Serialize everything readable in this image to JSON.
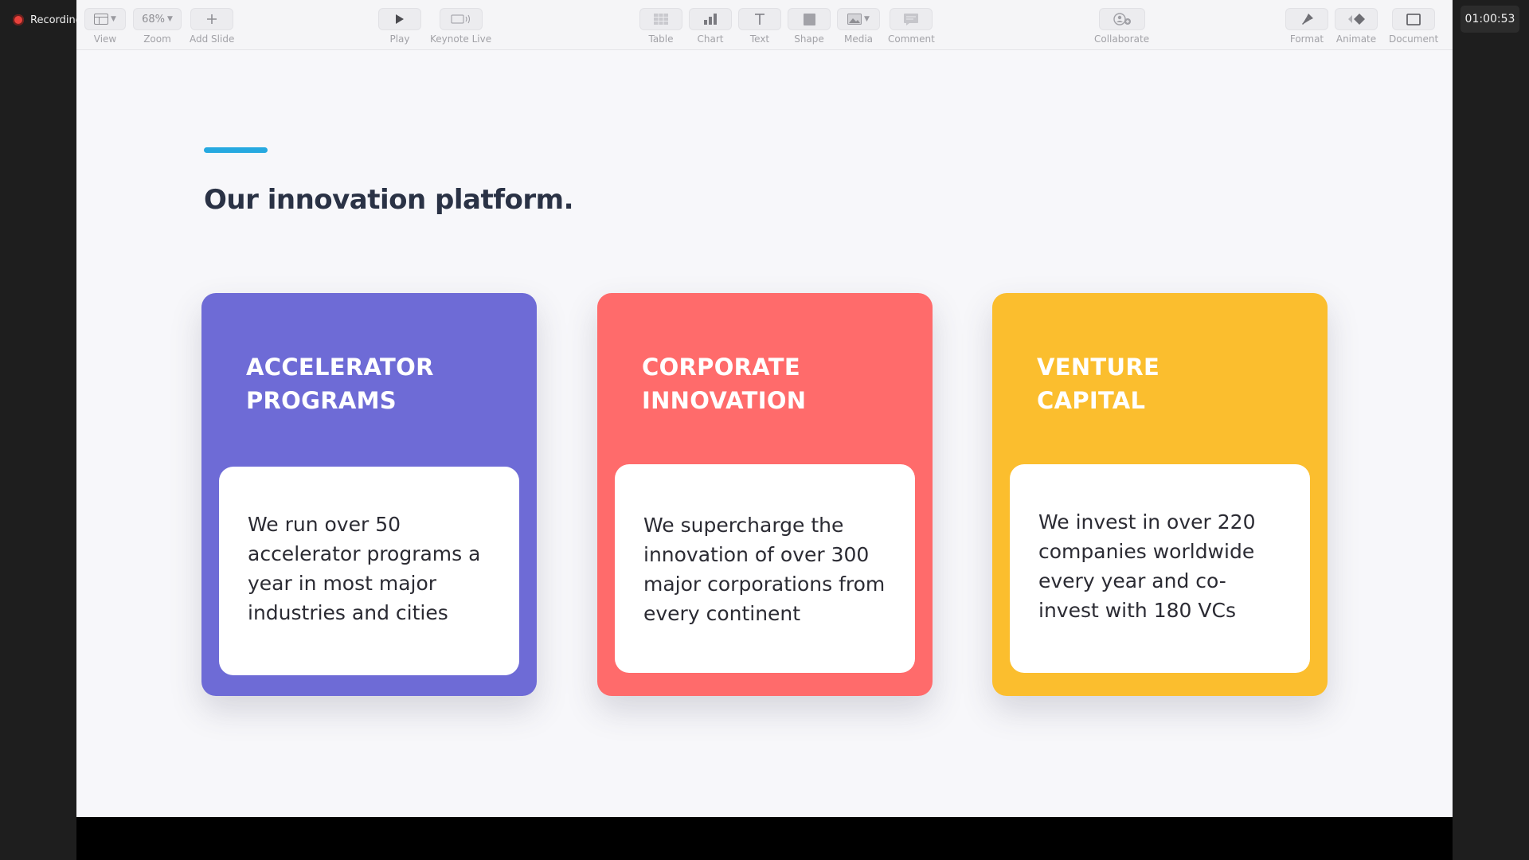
{
  "recording": {
    "label": "Recording"
  },
  "timer": {
    "value": "01:00:53"
  },
  "toolbar": {
    "view": {
      "label": "View",
      "icon": "sidebar-layout-icon"
    },
    "zoom": {
      "label": "Zoom",
      "value": "68%"
    },
    "add_slide": {
      "label": "Add Slide",
      "icon": "plus-icon"
    },
    "play": {
      "label": "Play",
      "icon": "play-icon"
    },
    "keynote_live": {
      "label": "Keynote Live",
      "icon": "broadcast-display-icon"
    },
    "table": {
      "label": "Table",
      "icon": "table-icon"
    },
    "chart": {
      "label": "Chart",
      "icon": "bar-chart-icon"
    },
    "text": {
      "label": "Text",
      "icon": "text-t-icon"
    },
    "shape": {
      "label": "Shape",
      "icon": "square-shape-icon"
    },
    "media": {
      "label": "Media",
      "icon": "image-icon"
    },
    "comment": {
      "label": "Comment",
      "icon": "comment-icon"
    },
    "collaborate": {
      "label": "Collaborate",
      "icon": "collaborate-person-plus-icon"
    },
    "format": {
      "label": "Format",
      "icon": "paintbrush-icon"
    },
    "animate": {
      "label": "Animate",
      "icon": "diamond-animate-icon"
    },
    "document": {
      "label": "Document",
      "icon": "document-icon"
    }
  },
  "slide": {
    "accent_color": "#26a9e0",
    "title": "Our innovation platform.",
    "cards": [
      {
        "title_line1": "ACCELERATOR",
        "title_line2": "PROGRAMS",
        "text": "We run over 50 accelerator programs a year in most major industries and cities",
        "color": "#6e6bd6"
      },
      {
        "title_line1": "CORPORATE",
        "title_line2": "INNOVATION",
        "text": "We supercharge the innovation of over 300 major corporations from every continent",
        "color": "#ff6b6b"
      },
      {
        "title_line1": "VENTURE",
        "title_line2": "CAPITAL",
        "text": "We invest in over 220 companies worldwide every year and co-invest with 180 VCs",
        "color": "#fbbe2e"
      }
    ]
  }
}
